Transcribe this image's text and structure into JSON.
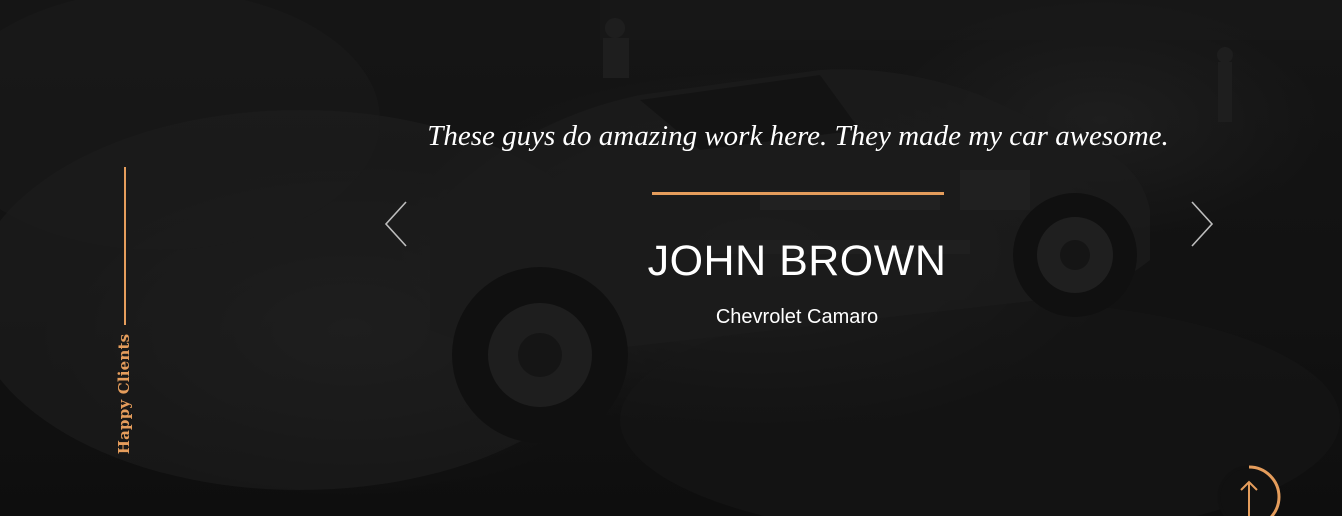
{
  "section": {
    "label": "Happy Clients"
  },
  "testimonial": {
    "quote": "These guys do amazing work here. They made my car awesome.",
    "name": "JOHN BROWN",
    "car": "Chevrolet Camaro"
  },
  "colors": {
    "accent": "#e59d5c",
    "text": "#ffffff",
    "background": "#151515"
  },
  "icons": {
    "prev": "chevron-left-icon",
    "next": "chevron-right-icon",
    "to_top": "arrow-up-icon"
  }
}
